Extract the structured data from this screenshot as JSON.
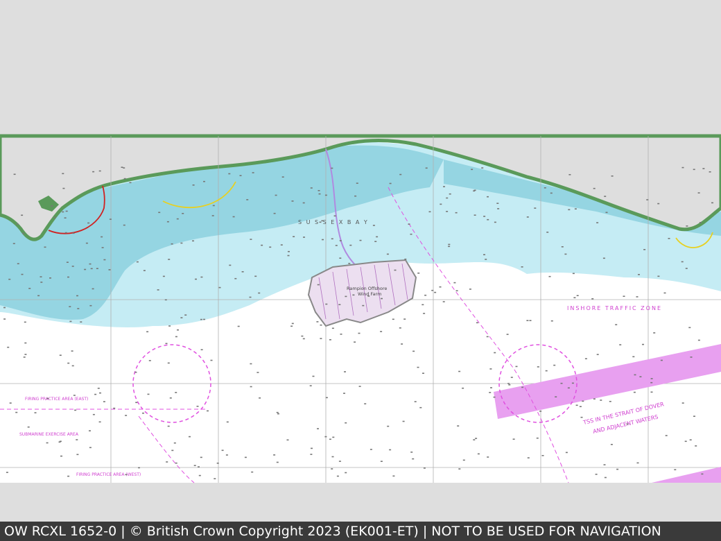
{
  "map": {
    "labels": {
      "sussex_bay": "S U S S E X   B A Y",
      "wind_farm_line1": "Rampion Offshore",
      "wind_farm_line2": "Wind Farm",
      "inshore_zone": "INSHORE TRAFFIC ZONE",
      "tss_line1": "TSS IN THE STRAIT OF DOVER",
      "tss_line2": "AND ADJACENT WATERS",
      "firing_east": "FIRING PRACTICE AREA (EAST)",
      "firing_west": "FIRING PRACTICE AREA (WEST)",
      "submarine_area": "SUBMARINE EXERCISE AREA"
    },
    "colors": {
      "land": "#dedede",
      "coast": "#5a9a5a",
      "shallow": "#95d5e2",
      "mid": "#c5ecf4",
      "deep": "#ffffff",
      "magenta": "#e050e0",
      "tss": "#e8a0f0"
    }
  },
  "footer": {
    "text": "OW RCXL 1652-0 | © British Crown Copyright 2023 (EK001-ET) | NOT TO BE USED FOR NAVIGATION"
  }
}
